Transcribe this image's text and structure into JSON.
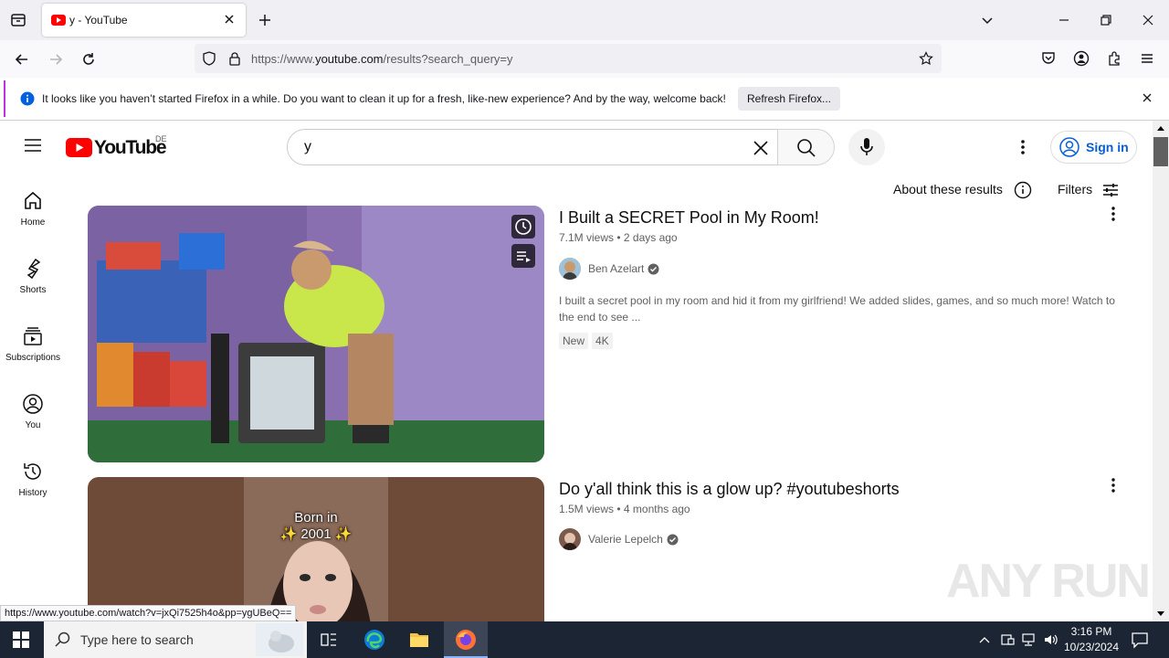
{
  "browser": {
    "tab_title": "y - YouTube",
    "url_prefix": "https://www.",
    "url_domain": "youtube.com",
    "url_suffix": "/results?search_query=y",
    "notification": "It looks like you haven’t started Firefox in a while. Do you want to clean it up for a fresh, like-new experience? And by the way, welcome back!",
    "refresh_button": "Refresh Firefox...",
    "status_url": "https://www.youtube.com/watch?v=jxQi7525h4o&pp=ygUBeQ=="
  },
  "youtube": {
    "logo_text": "YouTube",
    "region": "DE",
    "search_query": "y",
    "signin": "Sign in",
    "about_results": "About these results",
    "filters": "Filters",
    "sidebar": [
      {
        "label": "Home",
        "icon": "home-icon"
      },
      {
        "label": "Shorts",
        "icon": "shorts-icon"
      },
      {
        "label": "Subscriptions",
        "icon": "subscriptions-icon"
      },
      {
        "label": "You",
        "icon": "you-icon"
      },
      {
        "label": "History",
        "icon": "history-icon"
      }
    ],
    "videos": [
      {
        "title": "I Built a SECRET Pool in My Room!",
        "meta": "7.1M views • 2 days ago",
        "channel": "Ben Azelart",
        "description": "I built a secret pool in my room and hid it from my girlfriend! We added slides, games, and so much more! Watch to the end to see ...",
        "badges": [
          "New",
          "4K"
        ]
      },
      {
        "title": "Do y'all think this is a glow up? #youtubeshorts",
        "meta": "1.5M views • 4 months ago",
        "channel": "Valerie Lepelch",
        "overlay_line1": "Born in",
        "overlay_line2": "✨ 2001 ✨"
      }
    ]
  },
  "taskbar": {
    "search_placeholder": "Type here to search",
    "time": "3:16 PM",
    "date": "10/23/2024"
  },
  "watermark": "ANY RUN",
  "colors": {
    "youtube_red": "#ff0000",
    "link_blue": "#065fd4",
    "taskbar": "#1c2533",
    "notification_accent": "#b833e1"
  }
}
